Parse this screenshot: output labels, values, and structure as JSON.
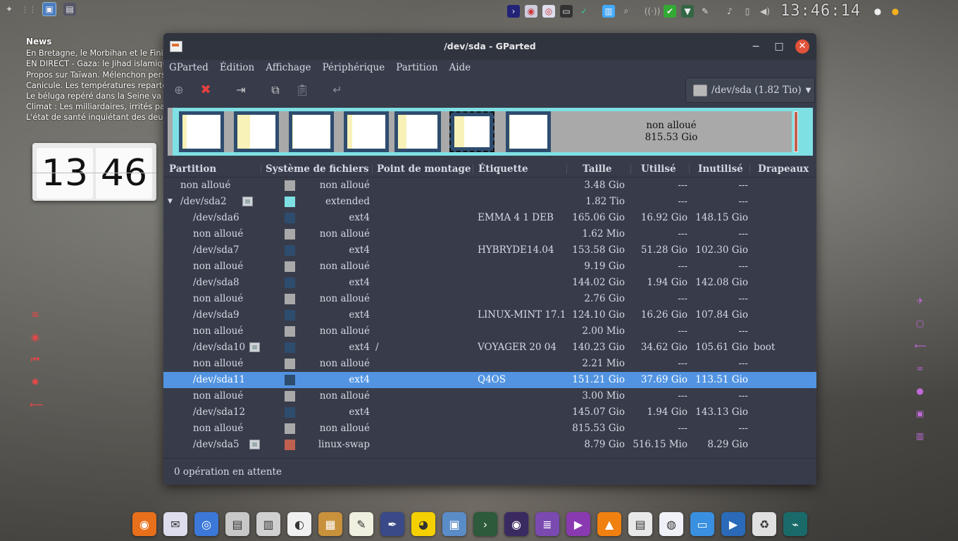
{
  "news": {
    "title": "News",
    "items": [
      "En Bretagne, le Morbihan et le Finistère",
      "EN DIRECT - Gaza: le Jihad islamique",
      "Propos sur Taïwan. Mélenchon persiste",
      "Canicule. Les températures repartent",
      "Le béluga repéré dans la Seine va mal",
      "Climat : Les milliardaires, irrités par",
      "L'état de santé inquiétant des deux"
    ]
  },
  "top_clock": "13:46:14",
  "flip_clock": {
    "hours": "13",
    "minutes": "46"
  },
  "window": {
    "title": "/dev/sda - GParted",
    "menu": [
      "GParted",
      "Édition",
      "Affichage",
      "Périphérique",
      "Partition",
      "Aide"
    ],
    "device": "/dev/sda (1.82 Tio)",
    "graph_unalloc_label": "non alloué",
    "graph_unalloc_size": "815.53 Gio",
    "columns": [
      "Partition",
      "Système de fichiers",
      "Point de montage",
      "Étiquette",
      "Taille",
      "Utilisé",
      "Inutilisé",
      "Drapeaux"
    ],
    "rows": [
      {
        "partition": "non alloué",
        "fs": "non alloué",
        "mount": "",
        "label": "",
        "size": "3.48 Gio",
        "used": "---",
        "unused": "---",
        "flags": "",
        "color": "#a9a9a9",
        "indent": 0,
        "lock": false
      },
      {
        "partition": "/dev/sda2",
        "fs": "extended",
        "mount": "",
        "label": "",
        "size": "1.82 Tio",
        "used": "---",
        "unused": "---",
        "flags": "",
        "color": "#7fe0e4",
        "indent": 0,
        "lock": true,
        "expander": "▼"
      },
      {
        "partition": "/dev/sda6",
        "fs": "ext4",
        "mount": "",
        "label": "EMMA 4 1 DEB",
        "size": "165.06 Gio",
        "used": "16.92 Gio",
        "unused": "148.15 Gio",
        "flags": "",
        "color": "#2e4c6e",
        "indent": 1,
        "lock": false
      },
      {
        "partition": "non alloué",
        "fs": "non alloué",
        "mount": "",
        "label": "",
        "size": "1.62 Mio",
        "used": "---",
        "unused": "---",
        "flags": "",
        "color": "#a9a9a9",
        "indent": 1,
        "lock": false
      },
      {
        "partition": "/dev/sda7",
        "fs": "ext4",
        "mount": "",
        "label": "HYBRYDE14.04",
        "size": "153.58 Gio",
        "used": "51.28 Gio",
        "unused": "102.30 Gio",
        "flags": "",
        "color": "#2e4c6e",
        "indent": 1,
        "lock": false
      },
      {
        "partition": "non alloué",
        "fs": "non alloué",
        "mount": "",
        "label": "",
        "size": "9.19 Gio",
        "used": "---",
        "unused": "---",
        "flags": "",
        "color": "#a9a9a9",
        "indent": 1,
        "lock": false
      },
      {
        "partition": "/dev/sda8",
        "fs": "ext4",
        "mount": "",
        "label": "",
        "size": "144.02 Gio",
        "used": "1.94 Gio",
        "unused": "142.08 Gio",
        "flags": "",
        "color": "#2e4c6e",
        "indent": 1,
        "lock": false
      },
      {
        "partition": "non alloué",
        "fs": "non alloué",
        "mount": "",
        "label": "",
        "size": "2.76 Gio",
        "used": "---",
        "unused": "---",
        "flags": "",
        "color": "#a9a9a9",
        "indent": 1,
        "lock": false
      },
      {
        "partition": "/dev/sda9",
        "fs": "ext4",
        "mount": "",
        "label": "LINUX-MINT 17.1",
        "size": "124.10 Gio",
        "used": "16.26 Gio",
        "unused": "107.84 Gio",
        "flags": "",
        "color": "#2e4c6e",
        "indent": 1,
        "lock": false
      },
      {
        "partition": "non alloué",
        "fs": "non alloué",
        "mount": "",
        "label": "",
        "size": "2.00 Mio",
        "used": "---",
        "unused": "---",
        "flags": "",
        "color": "#a9a9a9",
        "indent": 1,
        "lock": false
      },
      {
        "partition": "/dev/sda10",
        "fs": "ext4",
        "mount": "/",
        "label": "VOYAGER 20 04",
        "size": "140.23 Gio",
        "used": "34.62 Gio",
        "unused": "105.61 Gio",
        "flags": "boot",
        "color": "#2e4c6e",
        "indent": 1,
        "lock": true
      },
      {
        "partition": "non alloué",
        "fs": "non alloué",
        "mount": "",
        "label": "",
        "size": "2.21 Mio",
        "used": "---",
        "unused": "---",
        "flags": "",
        "color": "#a9a9a9",
        "indent": 1,
        "lock": false
      },
      {
        "partition": "/dev/sda11",
        "fs": "ext4",
        "mount": "",
        "label": "Q4OS",
        "size": "151.21 Gio",
        "used": "37.69 Gio",
        "unused": "113.51 Gio",
        "flags": "",
        "color": "#2e4c6e",
        "indent": 1,
        "lock": false,
        "selected": true
      },
      {
        "partition": "non alloué",
        "fs": "non alloué",
        "mount": "",
        "label": "",
        "size": "3.00 Mio",
        "used": "---",
        "unused": "---",
        "flags": "",
        "color": "#a9a9a9",
        "indent": 1,
        "lock": false
      },
      {
        "partition": "/dev/sda12",
        "fs": "ext4",
        "mount": "",
        "label": "",
        "size": "145.07 Gio",
        "used": "1.94 Gio",
        "unused": "143.13 Gio",
        "flags": "",
        "color": "#2e4c6e",
        "indent": 1,
        "lock": false
      },
      {
        "partition": "non alloué",
        "fs": "non alloué",
        "mount": "",
        "label": "",
        "size": "815.53 Gio",
        "used": "---",
        "unused": "---",
        "flags": "",
        "color": "#a9a9a9",
        "indent": 1,
        "lock": false
      },
      {
        "partition": "/dev/sda5",
        "fs": "linux-swap",
        "mount": "",
        "label": "",
        "size": "8.79 Gio",
        "used": "516.15 Mio",
        "unused": "8.29 Gio",
        "flags": "",
        "color": "#c06050",
        "indent": 1,
        "lock": true
      }
    ],
    "status": "0 opération en attente"
  },
  "colors": {
    "accent": "#5294e2",
    "ext4": "#2e4c6e",
    "extended": "#7fe0e4",
    "unallocated": "#a9a9a9",
    "swap": "#c06050",
    "close": "#e0523a"
  },
  "dock_icons": [
    "firefox-icon",
    "mail-icon",
    "chromium-icon",
    "files-icon",
    "mixer-icon",
    "cd-burner-icon",
    "archive-icon",
    "editor-icon",
    "inkscape-icon",
    "pacman-icon",
    "photo-icon",
    "terminal-icon",
    "music-icon",
    "sql-icon",
    "video-icon",
    "vlc-icon",
    "slides-icon",
    "store-icon",
    "window-icon",
    "media-icon",
    "trash-icon",
    "network-icon"
  ]
}
